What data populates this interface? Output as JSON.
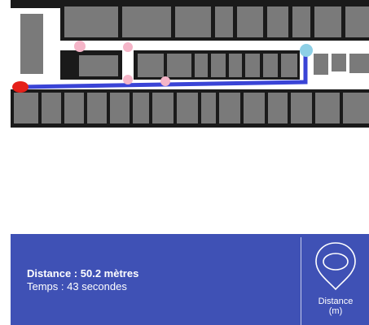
{
  "map": {
    "colors": {
      "background": "#1a1a1a",
      "room": "#7a7a7a",
      "corridor": "#ffffff",
      "route": "#3a44d6",
      "start_marker": "#e52019",
      "end_marker": "#8ed0e6",
      "waypoint_marker": "#f5b5c8"
    }
  },
  "info": {
    "distance": "Distance : 50.2 mètres",
    "time": "Temps : 43 secondes"
  },
  "distance_button": {
    "icon": "location-pin-icon",
    "label_line1": "Distance",
    "label_line2": "(m)"
  },
  "colors": {
    "panel": "#3f51b5",
    "panel_text": "#ffffff"
  }
}
